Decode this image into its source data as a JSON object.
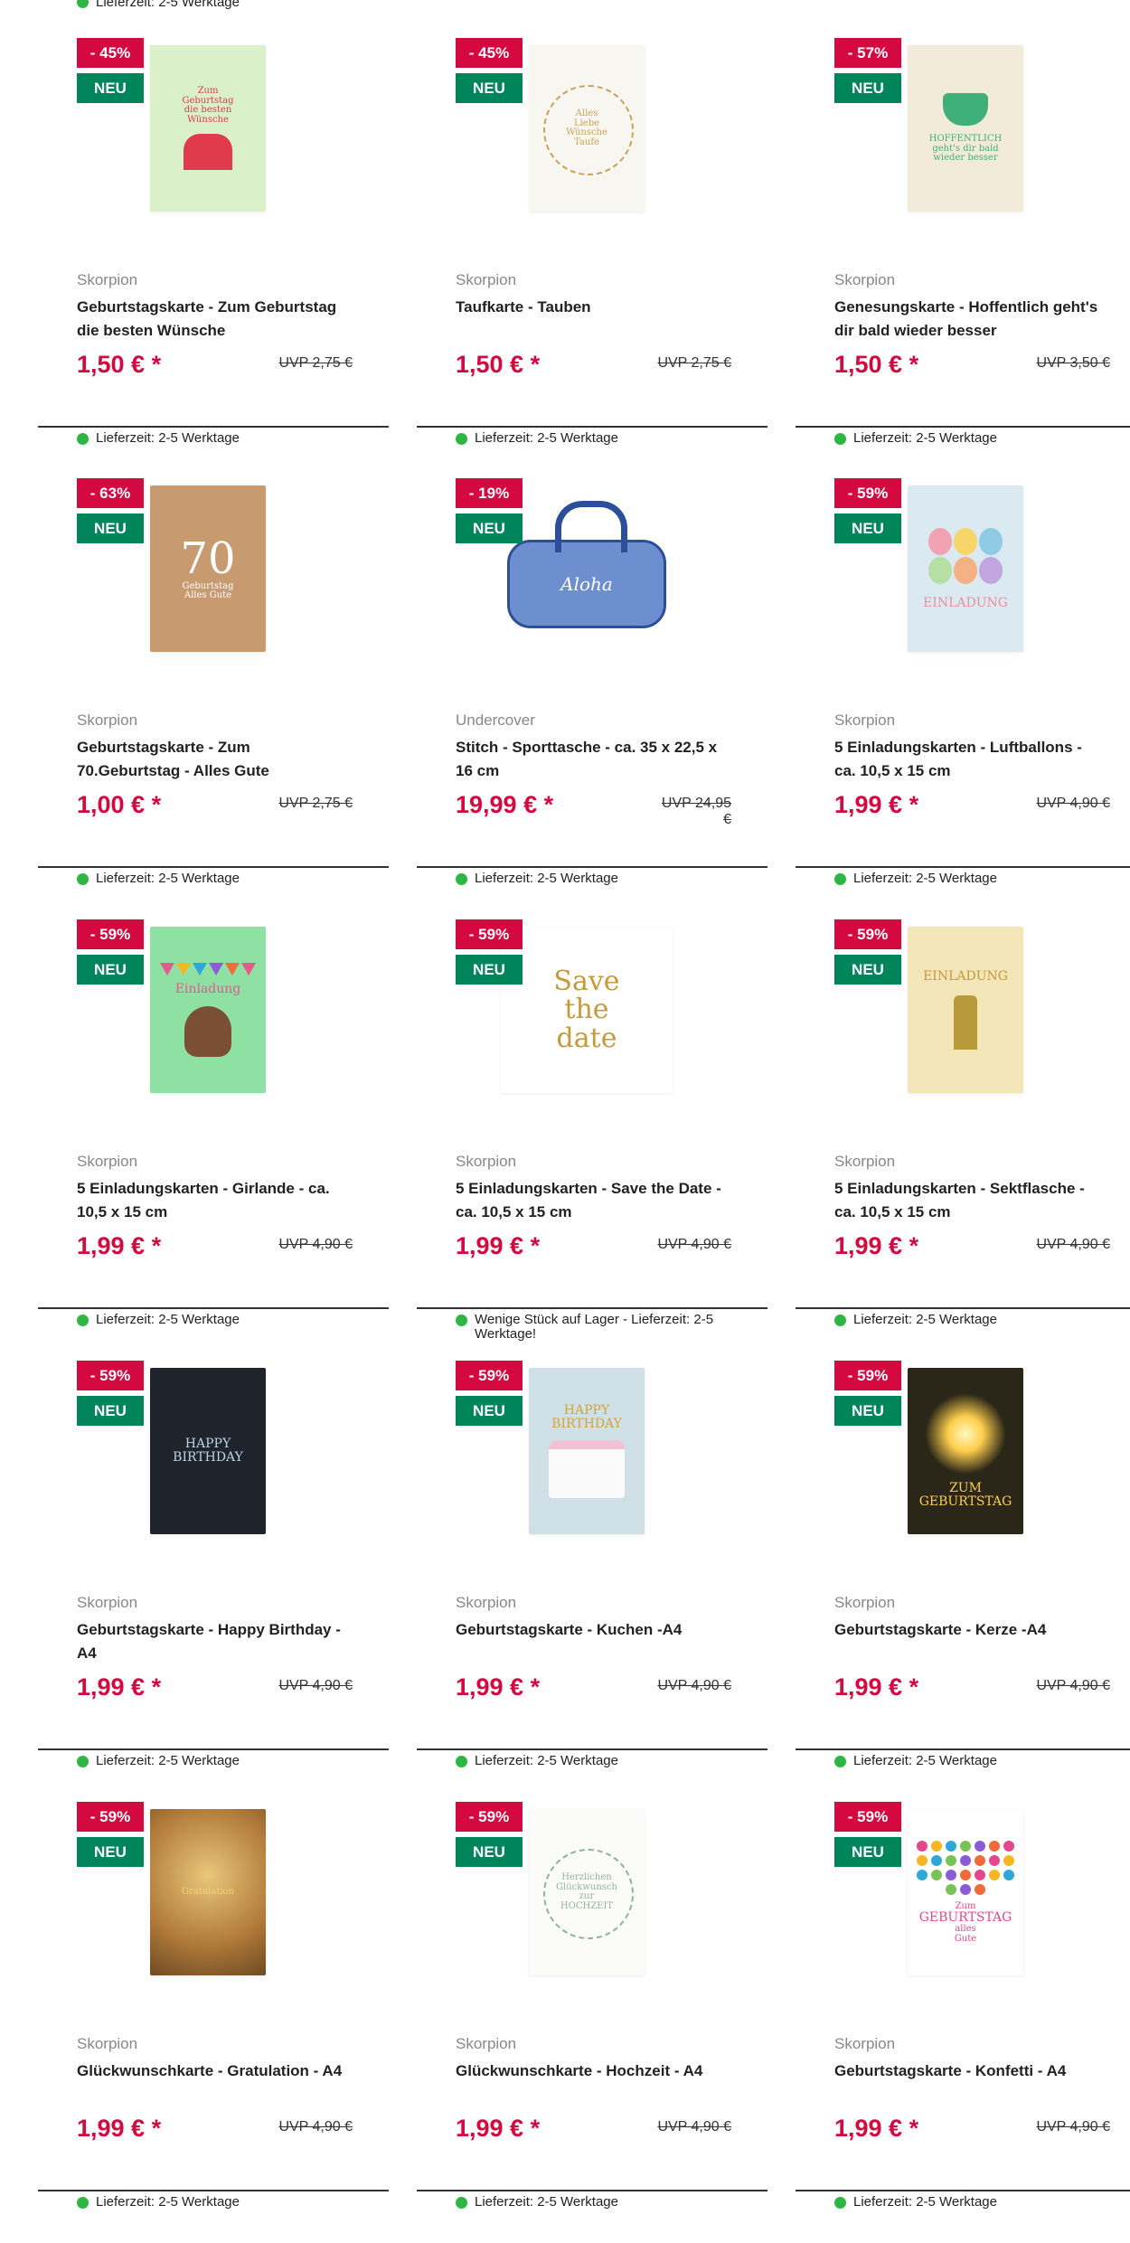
{
  "top_partial": {
    "delivery": "Lieferzeit: 2-5 Werktage"
  },
  "products": [
    {
      "discount": "- 45%",
      "badge": "NEU",
      "brand": "Skorpion",
      "title": "Geburtstagskarte - Zum Geburtstag die besten Wünsche",
      "price": "1,50 € *",
      "uvp": "UVP 2,75 €",
      "delivery": "Lieferzeit: 2-5 Werktage",
      "image": {
        "icon": "farm-card-image",
        "bg": "#d9f0c9",
        "accent": "#e23a4d",
        "lines": [
          "Zum",
          "Geburtstag",
          "die besten",
          "Wünsche"
        ]
      }
    },
    {
      "discount": "- 45%",
      "badge": "NEU",
      "brand": "Skorpion",
      "title": "Taufkarte - Tauben",
      "price": "1,50 € *",
      "uvp": "UVP 2,75 €",
      "delivery": "Lieferzeit: 2-5 Werktage",
      "image": {
        "icon": "wreath-card-image",
        "bg": "#f7f6f1",
        "accent": "#c8a455",
        "lines": [
          "Alles",
          "Liebe",
          "Wünsche",
          "Taufe"
        ]
      }
    },
    {
      "discount": "- 57%",
      "badge": "NEU",
      "brand": "Skorpion",
      "title": "Genesungskarte - Hoffentlich geht's dir bald wieder besser",
      "price": "1,50 € *",
      "uvp": "UVP 3,50 €",
      "delivery": "Lieferzeit: 2-5 Werktage",
      "image": {
        "icon": "teacup-card-image",
        "bg": "#f3ebd9",
        "accent": "#3fb07a",
        "lines": [
          "HOFFENTLICH",
          "geht's dir bald",
          "wieder besser"
        ]
      }
    },
    {
      "discount": "- 63%",
      "badge": "NEU",
      "brand": "Skorpion",
      "title": "Geburtstagskarte - Zum 70.Geburtstag - Alles Gute",
      "price": "1,00 € *",
      "uvp": "UVP 2,75 €",
      "delivery": "Lieferzeit: 2-5 Werktage",
      "image": {
        "icon": "seventy-card-image",
        "bg": "#c89a70",
        "accent": "#ffffff",
        "lines": [
          "70",
          "Geburtstag",
          "Alles Gute"
        ]
      }
    },
    {
      "discount": "- 19%",
      "badge": "NEU",
      "brand": "Undercover",
      "title": "Stitch - Sporttasche - ca. 35 x 22,5 x 16 cm",
      "price": "19,99 € *",
      "uvp": "UVP 24,95 €",
      "delivery": "Lieferzeit: 2-5 Werktage",
      "image": {
        "icon": "sports-bag-image",
        "bg": "#6d8fd0",
        "accent": "#2d4f99",
        "lines": [
          "Aloha"
        ]
      }
    },
    {
      "discount": "- 59%",
      "badge": "NEU",
      "brand": "Skorpion",
      "title": "5 Einladungskarten - Luftballons - ca. 10,5 x 15 cm",
      "price": "1,99 € *",
      "uvp": "UVP 4,90 €",
      "delivery": "Lieferzeit: 2-5 Werktage",
      "image": {
        "icon": "balloons-card-image",
        "bg": "#dbeaf1",
        "accent": "#e98f9f",
        "lines": [
          "EINLADUNG"
        ]
      }
    },
    {
      "discount": "- 59%",
      "badge": "NEU",
      "brand": "Skorpion",
      "title": "5 Einladungskarten - Girlande - ca. 10,5 x 15 cm",
      "price": "1,99 € *",
      "uvp": "UVP 4,90 €",
      "delivery": "Lieferzeit: 2-5 Werktage",
      "image": {
        "icon": "garland-card-image",
        "bg": "#8fe0a3",
        "accent": "#e65a8b",
        "lines": [
          "Einladung"
        ]
      }
    },
    {
      "discount": "- 59%",
      "badge": "NEU",
      "brand": "Skorpion",
      "title": "5 Einladungskarten - Save the Date - ca. 10,5 x 15 cm",
      "price": "1,99 € *",
      "uvp": "UVP 4,90 €",
      "delivery": "Wenige Stück auf Lager - Lieferzeit: 2-5 Werktage!",
      "image": {
        "icon": "save-the-date-card-image",
        "bg": "#ffffff",
        "accent": "#c49a3a",
        "lines": [
          "Save",
          "the",
          "date"
        ]
      }
    },
    {
      "discount": "- 59%",
      "badge": "NEU",
      "brand": "Skorpion",
      "title": "5 Einladungskarten - Sektflasche - ca. 10,5 x 15 cm",
      "price": "1,99 € *",
      "uvp": "UVP 4,90 €",
      "delivery": "Lieferzeit: 2-5 Werktage",
      "image": {
        "icon": "champagne-bottle-card-image",
        "bg": "#f3e6b8",
        "accent": "#c49a3a",
        "lines": [
          "EINLADUNG"
        ]
      }
    },
    {
      "discount": "- 59%",
      "badge": "NEU",
      "brand": "Skorpion",
      "title": "Geburtstagskarte - Happy Birthday - A4",
      "price": "1,99 € *",
      "uvp": "UVP 4,90 €",
      "delivery": "Lieferzeit: 2-5 Werktage",
      "image": {
        "icon": "happy-birthday-dark-card-image",
        "bg": "#1f232b",
        "accent": "#b9d3e3",
        "lines": [
          "HAPPY",
          "BIRTHDAY"
        ]
      }
    },
    {
      "discount": "- 59%",
      "badge": "NEU",
      "brand": "Skorpion",
      "title": "Geburtstagskarte - Kuchen -A4",
      "price": "1,99 € *",
      "uvp": "UVP 4,90 €",
      "delivery": "Lieferzeit: 2-5 Werktage",
      "image": {
        "icon": "cake-card-image",
        "bg": "#cfe0e6",
        "accent": "#d5a437",
        "lines": [
          "HAPPY",
          "BIRTHDAY"
        ]
      }
    },
    {
      "discount": "- 59%",
      "badge": "NEU",
      "brand": "Skorpion",
      "title": "Geburtstagskarte - Kerze -A4",
      "price": "1,99 € *",
      "uvp": "UVP 4,90 €",
      "delivery": "Lieferzeit: 2-5 Werktage",
      "image": {
        "icon": "sparkler-card-image",
        "bg": "#2a2618",
        "accent": "#ffcf4d",
        "lines": [
          "ZUM",
          "GEBURTSTAG"
        ]
      }
    },
    {
      "discount": "- 59%",
      "badge": "NEU",
      "brand": "Skorpion",
      "title": "Glückwunschkarte - Gratulation - A4",
      "price": "1,99 € *",
      "uvp": "UVP 4,90 €",
      "delivery": "Lieferzeit: 2-5 Werktage",
      "image": {
        "icon": "champagne-glasses-card-image",
        "bg": "#b07a3a",
        "accent": "#f3d27a",
        "lines": [
          "Gratulation"
        ]
      }
    },
    {
      "discount": "- 59%",
      "badge": "NEU",
      "brand": "Skorpion",
      "title": "Glückwunschkarte - Hochzeit - A4",
      "price": "1,99 € *",
      "uvp": "UVP 4,90 €",
      "delivery": "Lieferzeit: 2-5 Werktage",
      "image": {
        "icon": "wedding-wreath-card-image",
        "bg": "#fbfbf8",
        "accent": "#8fb39a",
        "lines": [
          "Herzlichen",
          "Glückwunsch",
          "zur",
          "HOCHZEIT"
        ]
      }
    },
    {
      "discount": "- 59%",
      "badge": "NEU",
      "brand": "Skorpion",
      "title": "Geburtstagskarte - Konfetti - A4",
      "price": "1,99 € *",
      "uvp": "UVP 4,90 €",
      "delivery": "Lieferzeit: 2-5 Werktage",
      "image": {
        "icon": "confetti-card-image",
        "bg": "#ffffff",
        "accent": "#e2488b",
        "lines": [
          "Zum",
          "GEBURTSTAG",
          "alles",
          "Gute"
        ]
      }
    }
  ]
}
